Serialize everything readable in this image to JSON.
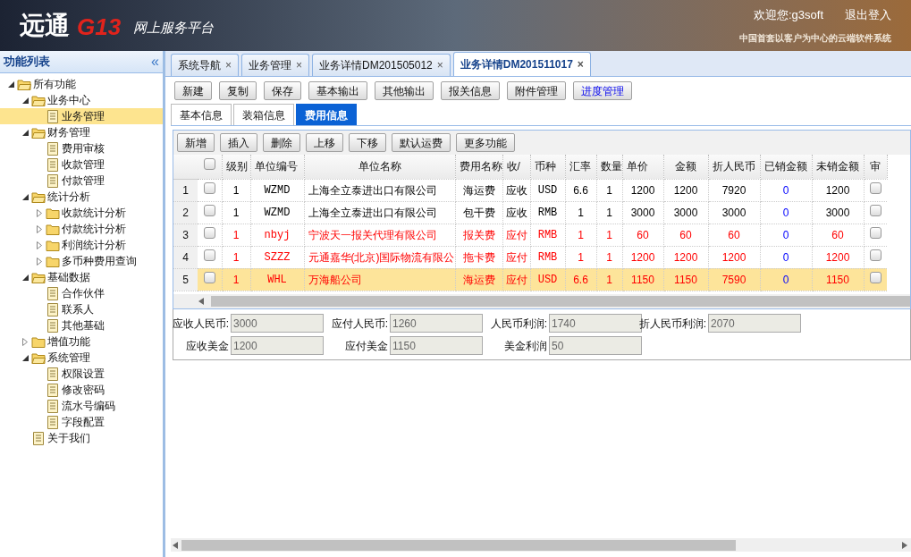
{
  "header": {
    "logo_text": "远通",
    "logo_mark": "G13",
    "platform": "网上服务平台",
    "welcome": "欢迎您:g3soft",
    "logout": "退出登入",
    "tagline": "中国首套以客户为中心的云端软件系统"
  },
  "sidebar": {
    "title": "功能列表",
    "collapse": "«",
    "tree": [
      {
        "label": "所有功能",
        "kind": "folder",
        "expanded": true,
        "selected": false,
        "children": [
          {
            "label": "业务中心",
            "kind": "folder",
            "expanded": true,
            "selected": false,
            "children": [
              {
                "label": "业务管理",
                "kind": "doc",
                "selected": true
              }
            ]
          },
          {
            "label": "财务管理",
            "kind": "folder",
            "expanded": true,
            "selected": false,
            "children": [
              {
                "label": "费用审核",
                "kind": "doc",
                "selected": false
              },
              {
                "label": "收款管理",
                "kind": "doc",
                "selected": false
              },
              {
                "label": "付款管理",
                "kind": "doc",
                "selected": false
              }
            ]
          },
          {
            "label": "统计分析",
            "kind": "folder",
            "expanded": true,
            "selected": false,
            "children": [
              {
                "label": "收款统计分析",
                "kind": "folder",
                "expanded": false,
                "selected": false
              },
              {
                "label": "付款统计分析",
                "kind": "folder",
                "expanded": false,
                "selected": false
              },
              {
                "label": "利润统计分析",
                "kind": "folder",
                "expanded": false,
                "selected": false
              },
              {
                "label": "多币种费用查询",
                "kind": "folder",
                "expanded": false,
                "selected": false
              }
            ]
          },
          {
            "label": "基础数据",
            "kind": "folder",
            "expanded": true,
            "selected": false,
            "children": [
              {
                "label": "合作伙伴",
                "kind": "doc",
                "selected": false
              },
              {
                "label": "联系人",
                "kind": "doc",
                "selected": false
              },
              {
                "label": "其他基础",
                "kind": "doc",
                "selected": false
              }
            ]
          },
          {
            "label": "增值功能",
            "kind": "folder",
            "expanded": false,
            "selected": false
          },
          {
            "label": "系统管理",
            "kind": "folder",
            "expanded": true,
            "selected": false,
            "children": [
              {
                "label": "权限设置",
                "kind": "doc",
                "selected": false
              },
              {
                "label": "修改密码",
                "kind": "doc",
                "selected": false
              },
              {
                "label": "流水号编码",
                "kind": "doc",
                "selected": false
              },
              {
                "label": "字段配置",
                "kind": "doc",
                "selected": false
              }
            ]
          },
          {
            "label": "关于我们",
            "kind": "doc",
            "selected": false
          }
        ]
      }
    ]
  },
  "page_tabs": [
    {
      "label": "系统导航",
      "selected": false
    },
    {
      "label": "业务管理",
      "selected": false
    },
    {
      "label": "业务详情DM201505012",
      "selected": false
    },
    {
      "label": "业务详情DM201511017",
      "selected": true
    }
  ],
  "close_glyph": "×",
  "toolbar": [
    {
      "label": "新建",
      "highlight": false
    },
    {
      "label": "复制",
      "highlight": false
    },
    {
      "label": "保存",
      "highlight": false
    },
    {
      "label": "基本输出",
      "highlight": false
    },
    {
      "label": "其他输出",
      "highlight": false
    },
    {
      "label": "报关信息",
      "highlight": false
    },
    {
      "label": "附件管理",
      "highlight": false
    },
    {
      "label": "进度管理",
      "highlight": true
    }
  ],
  "sub_tabs": [
    {
      "label": "基本信息",
      "selected": false
    },
    {
      "label": "装箱信息",
      "selected": false
    },
    {
      "label": "费用信息",
      "selected": true
    }
  ],
  "grid_toolbar": [
    "新增",
    "插入",
    "删除",
    "上移",
    "下移",
    "默认运费",
    "更多功能"
  ],
  "table": {
    "select_all": {
      "checked": false
    },
    "columns": [
      "级别",
      "单位编号",
      "单位名称",
      "费用名称",
      "收/",
      "币种",
      "汇率",
      "数量",
      "单价",
      "金额",
      "折人民币",
      "已销金额",
      "未销金额",
      "审"
    ],
    "rows": [
      {
        "num": "1",
        "checked": false,
        "selected": false,
        "kind": "receivable",
        "cells": [
          "1",
          "WZMD",
          "上海全立泰进出口有限公司",
          "海运费",
          "应收",
          "USD",
          "6.6",
          "1",
          "1200",
          "1200",
          "7920",
          "0",
          "1200"
        ],
        "audited": false
      },
      {
        "num": "2",
        "checked": false,
        "selected": false,
        "kind": "receivable",
        "cells": [
          "1",
          "WZMD",
          "上海全立泰进出口有限公司",
          "包干费",
          "应收",
          "RMB",
          "1",
          "1",
          "3000",
          "3000",
          "3000",
          "0",
          "3000"
        ],
        "audited": false
      },
      {
        "num": "3",
        "checked": false,
        "selected": false,
        "kind": "payable",
        "cells": [
          "1",
          "nbyj",
          "宁波天一报关代理有限公司",
          "报关费",
          "应付",
          "RMB",
          "1",
          "1",
          "60",
          "60",
          "60",
          "0",
          "60"
        ],
        "audited": false
      },
      {
        "num": "4",
        "checked": false,
        "selected": false,
        "kind": "payable",
        "cells": [
          "1",
          "SZZZ",
          "元通嘉华(北京)国际物流有限公",
          "拖卡费",
          "应付",
          "RMB",
          "1",
          "1",
          "1200",
          "1200",
          "1200",
          "0",
          "1200"
        ],
        "audited": false
      },
      {
        "num": "5",
        "checked": false,
        "selected": true,
        "kind": "payable",
        "cells": [
          "1",
          "WHL",
          "万海船公司",
          "海运费",
          "应付",
          "USD",
          "6.6",
          "1",
          "1150",
          "1150",
          "7590",
          "0",
          "1150"
        ],
        "audited": false
      }
    ]
  },
  "summary": [
    [
      {
        "label": "应收人民币:",
        "value": "3000"
      },
      {
        "label": "应付人民币:",
        "value": "1260"
      },
      {
        "label": "人民币利润:",
        "value": "1740"
      },
      {
        "label": "折人民币利润:",
        "value": "2070"
      }
    ],
    [
      {
        "label": "应收美金",
        "value": "1200"
      },
      {
        "label": "应付美金",
        "value": "1150"
      },
      {
        "label": "美金利润",
        "value": "50"
      }
    ]
  ]
}
